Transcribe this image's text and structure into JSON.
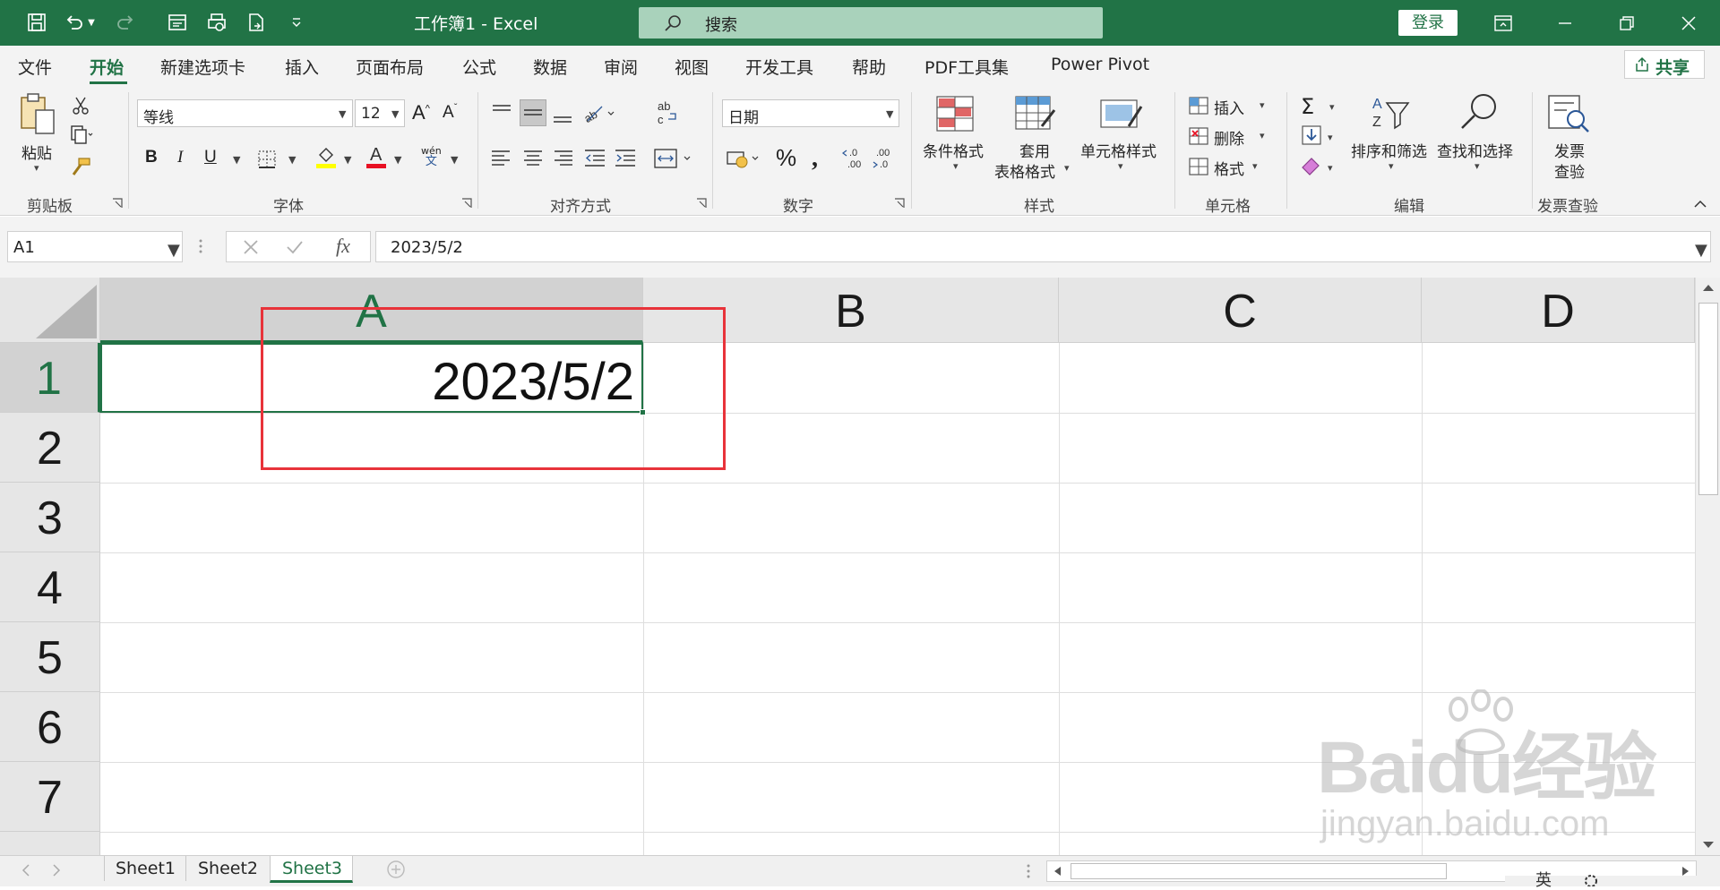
{
  "titlebar": {
    "title": "工作簿1  -  Excel",
    "search_placeholder": "搜索",
    "login_label": "登录",
    "bg_color": "#217346"
  },
  "tabs": [
    "文件",
    "开始",
    "新建选项卡",
    "插入",
    "页面布局",
    "公式",
    "数据",
    "审阅",
    "视图",
    "开发工具",
    "帮助",
    "PDF工具集",
    "Power Pivot"
  ],
  "active_tab": "开始",
  "share_label": "共享",
  "ribbon": {
    "clipboard": {
      "paste": "粘贴",
      "group": "剪贴板"
    },
    "font": {
      "name": "等线",
      "size": "12",
      "group": "字体",
      "wen": "wén",
      "wen2": "文"
    },
    "alignment": {
      "group": "对齐方式"
    },
    "number": {
      "format": "日期",
      "group": "数字"
    },
    "styles": {
      "cond": "条件格式",
      "table_1": "套用",
      "table_2": "表格格式",
      "cell": "单元格样式",
      "group": "样式"
    },
    "cells": {
      "insert": "插入",
      "delete": "删除",
      "format": "格式",
      "group": "单元格"
    },
    "editing": {
      "sort": "排序和筛选",
      "find": "查找和选择",
      "group": "编辑"
    },
    "invoice": {
      "btn_1": "发票",
      "btn_2": "查验",
      "group": "发票查验"
    }
  },
  "formula_bar": {
    "name_box": "A1",
    "formula": "2023/5/2"
  },
  "grid": {
    "columns": [
      "A",
      "B",
      "C",
      "D"
    ],
    "rows": [
      "1",
      "2",
      "3",
      "4",
      "5",
      "6",
      "7"
    ],
    "cell_A1": "2023/5/2"
  },
  "sheets": [
    "Sheet1",
    "Sheet2",
    "Sheet3"
  ],
  "active_sheet": "Sheet3",
  "watermark": {
    "main": "Baidu经验",
    "sub": "jingyan.baidu.com"
  },
  "status": {
    "ime": "英"
  }
}
